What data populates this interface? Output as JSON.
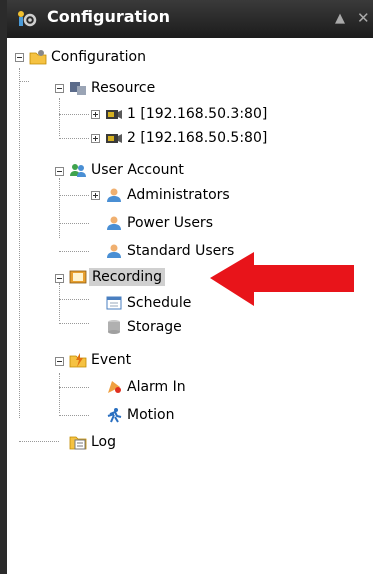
{
  "window": {
    "title": "Configuration",
    "pin_icon": "pin-icon",
    "close_icon": "close-icon"
  },
  "tree": {
    "root": "Configuration",
    "resource": {
      "label": "Resource",
      "items": [
        "1 [192.168.50.3:80]",
        "2 [192.168.50.5:80]"
      ]
    },
    "user_account": {
      "label": "User Account",
      "items": [
        "Administrators",
        "Power Users",
        "Standard Users"
      ]
    },
    "recording": {
      "label": "Recording",
      "items": [
        "Schedule",
        "Storage"
      ]
    },
    "event": {
      "label": "Event",
      "items": [
        "Alarm In",
        "Motion"
      ]
    },
    "log": "Log"
  },
  "selected_item": "Recording",
  "annotation": {
    "type": "arrow",
    "color": "#e8141a"
  }
}
